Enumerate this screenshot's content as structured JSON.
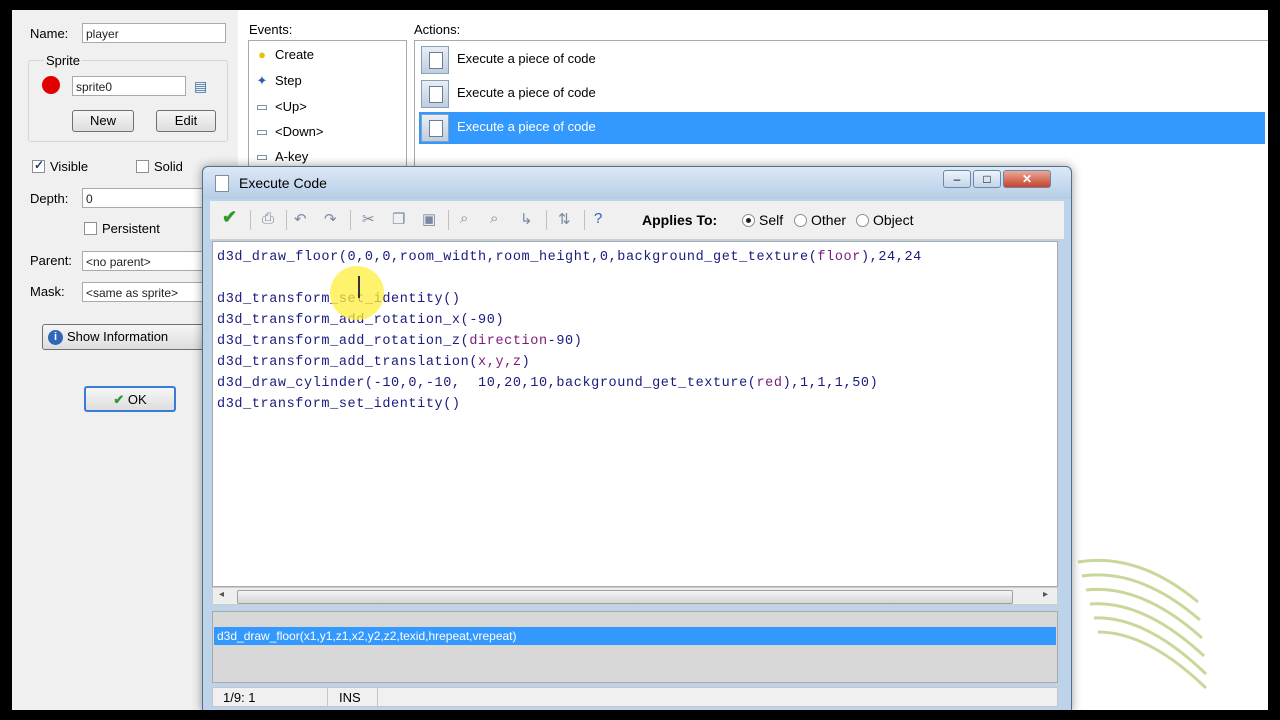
{
  "object": {
    "name_label": "Name:",
    "name_value": "player",
    "sprite_group": "Sprite",
    "sprite_value": "sprite0",
    "new_label": "New",
    "edit_label": "Edit",
    "visible_label": "Visible",
    "solid_label": "Solid",
    "depth_label": "Depth:",
    "depth_value": "0",
    "persistent_label": "Persistent",
    "parent_label": "Parent:",
    "parent_value": "<no parent>",
    "mask_label": "Mask:",
    "mask_value": "<same as sprite>",
    "show_info_label": "Show Information",
    "ok_label": "OK"
  },
  "events": {
    "header": "Events:",
    "items": [
      "Create",
      "Step",
      "<Up>",
      "<Down>",
      "A-key"
    ]
  },
  "actions": {
    "header": "Actions:",
    "items": [
      "Execute a piece of code",
      "Execute a piece of code",
      "Execute a piece of code"
    ]
  },
  "dialog": {
    "title": "Execute Code",
    "applies_to_label": "Applies To:",
    "self_label": "Self",
    "other_label": "Other",
    "object_label": "Object",
    "hint_text": "d3d_draw_floor(x1,y1,z1,x2,y2,z2,texid,hrepeat,vrepeat)",
    "status_position": "1/9:  1",
    "status_mode": "INS"
  },
  "code": {
    "l1_fn": "d3d_draw_floor",
    "l1_a": "(0,0,0,room_width,room_height,0,",
    "l1_fn2": "background_get_texture(",
    "l1_var": "floor",
    "l1_end": "),24,24",
    "l3": "d3d_transform_set_identity()",
    "l4": "d3d_transform_add_rotation_x(-90)",
    "l5_a": "d3d_transform_add_rotation_z(",
    "l5_var": "direction",
    "l5_end": "-90)",
    "l6_a": "d3d_transform_add_translation(",
    "l6_var": "x,y,z",
    "l6_end": ")",
    "l7_a": "d3d_draw_cylinder(-10,0,-10,  10,20,10,background_get_texture(",
    "l7_var": "red",
    "l7_end": "),1,1,1,50)",
    "l8": "d3d_transform_set_identity()"
  },
  "colors": {
    "selection": "#3399ff",
    "dialog_frame": "#bcd3ea",
    "code_text": "#1a1a80",
    "code_keyword": "#7a1a7a"
  }
}
